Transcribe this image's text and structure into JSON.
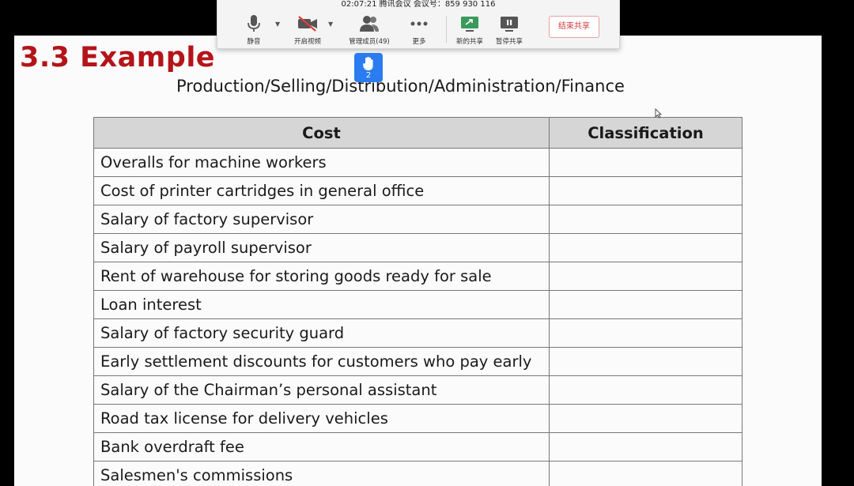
{
  "toolbar": {
    "meeting_info": "02:07:21  腾讯会议  会议号：859 930 116",
    "buttons": {
      "mute": "静音",
      "start_video": "开启视频",
      "manage_members": "管理成员(49)",
      "more": "更多",
      "new_share": "新的共享",
      "pause_share": "暂停共享",
      "end_share": "结束共享"
    },
    "accent_color": "#2a7cf0",
    "danger_color": "#d23c3c"
  },
  "raise_hand": {
    "count": "2"
  },
  "slide": {
    "heading": "3.3  Example",
    "heading_color": "#b41419",
    "subtitle": "Production/Selling/Distribution/Administration/Finance",
    "table": {
      "headers": [
        "Cost",
        "Classification"
      ],
      "rows": [
        "Overalls for machine workers",
        "Cost of printer cartridges in general office",
        "Salary of factory supervisor",
        "Salary of payroll supervisor",
        "Rent of warehouse for storing goods ready for sale",
        "Loan interest",
        "Salary of factory security guard",
        "Early settlement discounts for customers who pay early",
        "Salary of the Chairman’s personal assistant",
        "Road tax license for delivery vehicles",
        "Bank overdraft fee",
        "Salesmen's commissions"
      ]
    }
  }
}
